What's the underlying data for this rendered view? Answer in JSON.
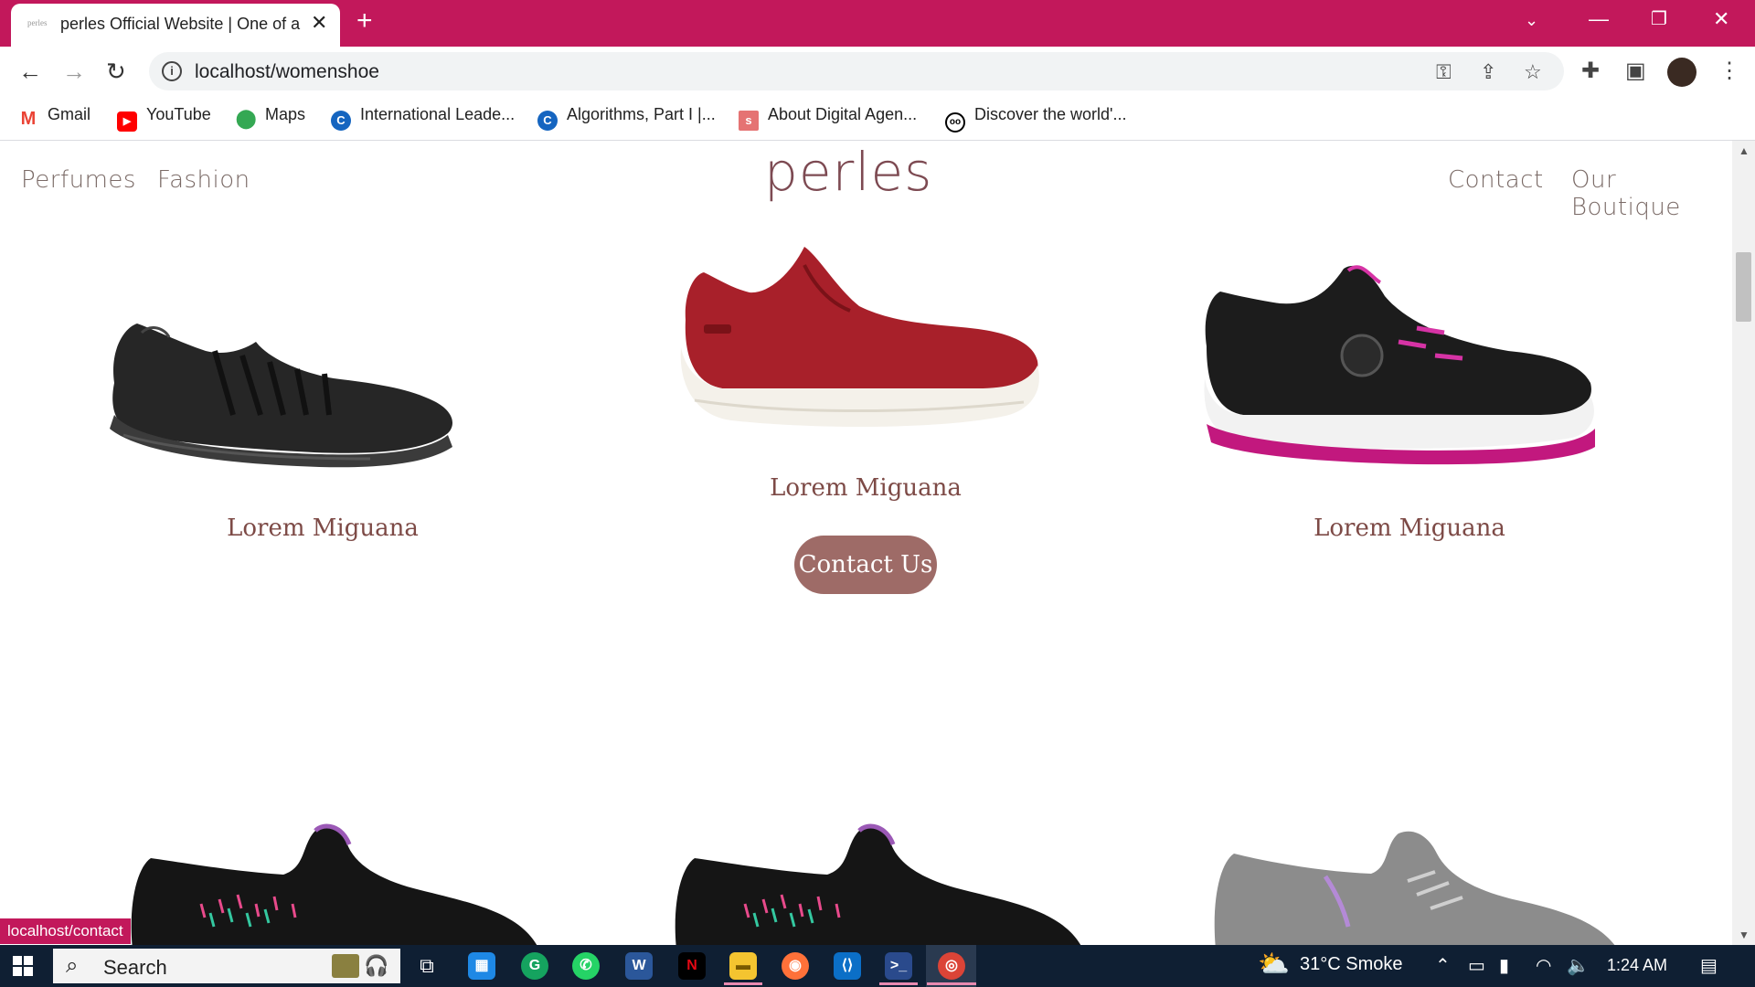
{
  "browser": {
    "tab_title": "perles Official Website | One of a",
    "tab_favicon_text": "perles",
    "url": "localhost/womenshoe",
    "bookmarks": [
      {
        "label": "Gmail",
        "icon": "gmail-icon"
      },
      {
        "label": "YouTube",
        "icon": "youtube-icon"
      },
      {
        "label": "Maps",
        "icon": "maps-icon"
      },
      {
        "label": "International Leade...",
        "icon": "c-icon"
      },
      {
        "label": "Algorithms, Part I |...",
        "icon": "c-icon"
      },
      {
        "label": "About Digital Agen...",
        "icon": "s-icon"
      },
      {
        "label": "Discover the world'...",
        "icon": "tripadvisor-icon"
      }
    ],
    "status_url": "localhost/contact",
    "accent_color": "#c2185b"
  },
  "site": {
    "logo": "perles",
    "nav_left": [
      "Perfumes",
      "Fashion"
    ],
    "nav_right": [
      "Contact",
      "Our Boutique"
    ],
    "products_row1": [
      {
        "name": "Lorem Miguana",
        "shoe_color": "black"
      },
      {
        "name": "Lorem Miguana",
        "shoe_color": "red"
      },
      {
        "name": "Lorem Miguana",
        "shoe_color": "black-pink"
      }
    ],
    "products_row2": [
      {
        "shoe_color": "black-multicolor"
      },
      {
        "shoe_color": "black-multicolor"
      },
      {
        "shoe_color": "grey"
      }
    ],
    "contact_button": "Contact Us",
    "text_color": "#7d4a46",
    "button_color": "#9e6b67"
  },
  "taskbar": {
    "search_placeholder": "Search",
    "weather": "31°C  Smoke",
    "time": "1:24 AM"
  }
}
